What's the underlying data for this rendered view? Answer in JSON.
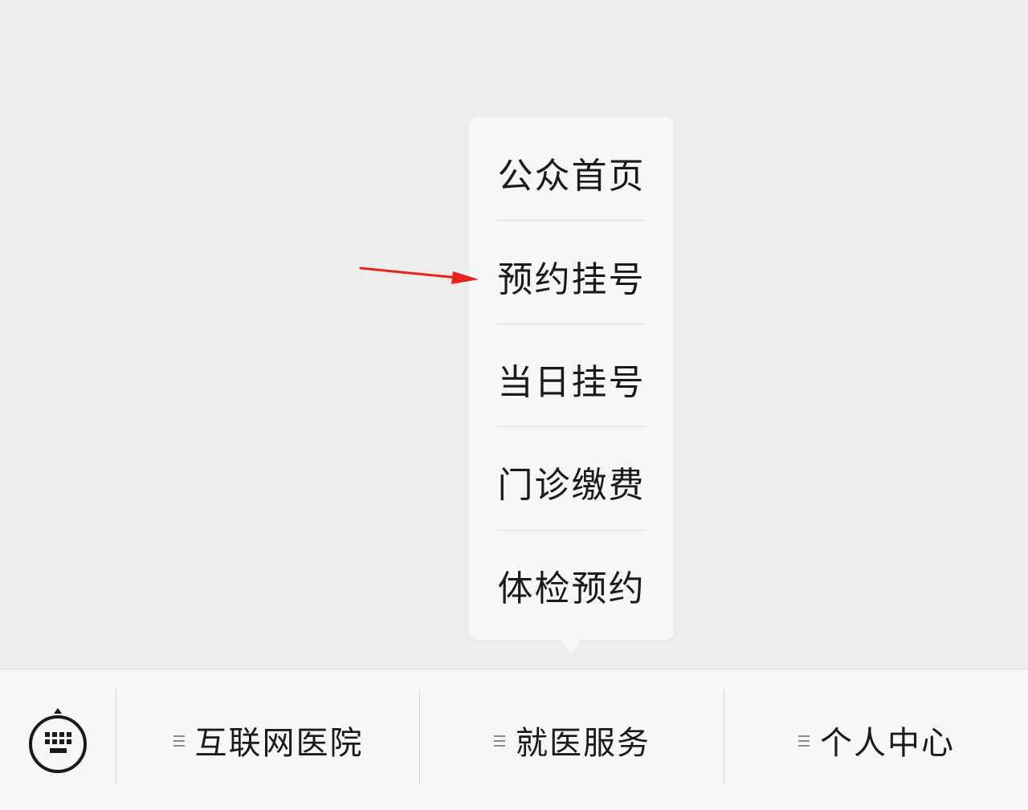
{
  "popup_menu": {
    "items": [
      {
        "label": "公众首页"
      },
      {
        "label": "预约挂号"
      },
      {
        "label": "当日挂号"
      },
      {
        "label": "门诊缴费"
      },
      {
        "label": "体检预约"
      }
    ]
  },
  "annotation": {
    "icon": "red-arrow-icon",
    "color": "#e8231c",
    "target": "预约挂号"
  },
  "menu_bar": {
    "keyboard_icon": "keyboard-icon",
    "menu_icon": "list-menu-icon",
    "tabs": [
      {
        "label": "互联网医院"
      },
      {
        "label": "就医服务"
      },
      {
        "label": "个人中心"
      }
    ]
  },
  "colors": {
    "background": "#ededed",
    "panel": "#f7f7f7",
    "divider": "#dcdcdc",
    "text": "#1a1a1a"
  }
}
